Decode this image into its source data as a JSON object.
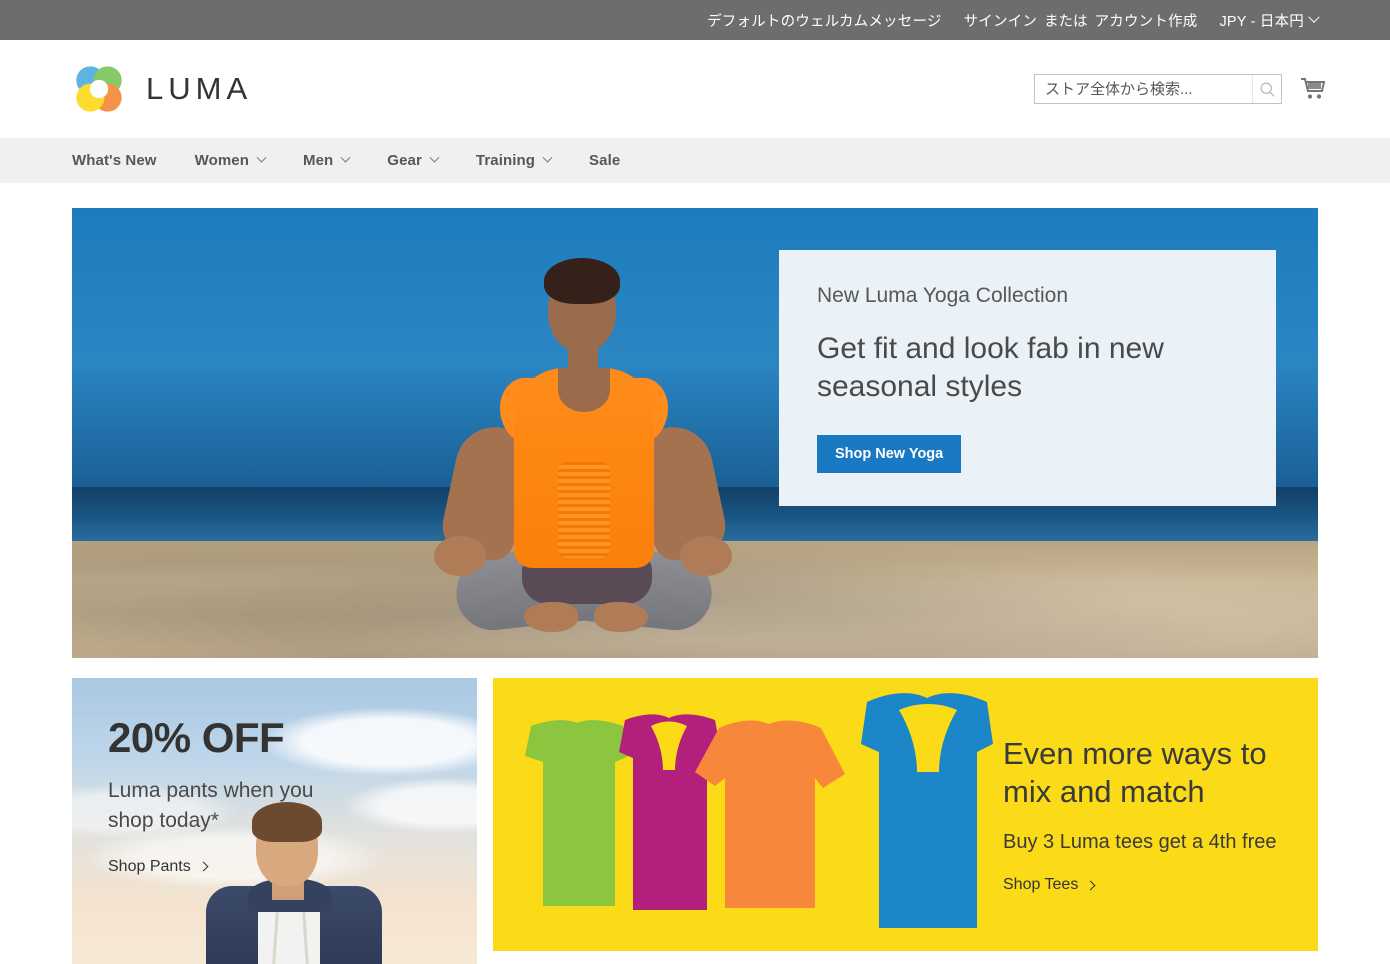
{
  "top_panel": {
    "welcome": "デフォルトのウェルカムメッセージ",
    "sign_in": "サインイン",
    "or": "または",
    "create_account": "アカウント作成",
    "currency": "JPY - 日本円"
  },
  "header": {
    "logo_text": "LUMA",
    "logo_icon": "luma-circles-logo",
    "search": {
      "placeholder": "ストア全体から検索...",
      "value": "",
      "icon": "search-icon"
    },
    "cart_icon": "shopping-cart-icon"
  },
  "nav": {
    "items": [
      {
        "label": "What's New",
        "has_dropdown": false
      },
      {
        "label": "Women",
        "has_dropdown": true
      },
      {
        "label": "Men",
        "has_dropdown": true
      },
      {
        "label": "Gear",
        "has_dropdown": true
      },
      {
        "label": "Training",
        "has_dropdown": true
      },
      {
        "label": "Sale",
        "has_dropdown": false
      }
    ]
  },
  "hero": {
    "image_alt": "woman meditating in lotus pose on beach",
    "eyebrow": "New Luma Yoga Collection",
    "title": "Get fit and look fab in new seasonal styles",
    "cta_label": "Shop New Yoga",
    "cta_color": "#1979c3",
    "panel_bg": "#eaf1f7"
  },
  "promos": {
    "pants": {
      "headline": "20% OFF",
      "subhead": "Luma pants when you shop today*",
      "link_label": "Shop Pants",
      "image_alt": "man in navy hoodie against sky"
    },
    "tees": {
      "headline": "Even more ways to mix and match",
      "subhead": "Buy 3 Luma tees get a 4th free",
      "link_label": "Shop Tees",
      "bg_color": "#fbda18",
      "garment_colors": [
        "#8cc63f",
        "#b2207c",
        "#f7883b",
        "#1b86c8"
      ]
    }
  }
}
